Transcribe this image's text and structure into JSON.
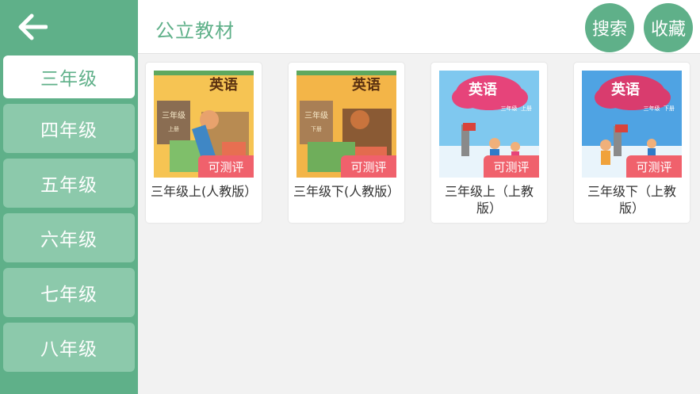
{
  "sidebar": {
    "grades": [
      {
        "label": "三年级"
      },
      {
        "label": "四年级"
      },
      {
        "label": "五年级"
      },
      {
        "label": "六年级"
      },
      {
        "label": "七年级"
      },
      {
        "label": "八年级"
      }
    ],
    "active_grade": "三年级"
  },
  "header": {
    "title": "公立教材",
    "search_label": "搜索",
    "favorites_label": "收藏"
  },
  "books": [
    {
      "title": "三年级上(人教版）",
      "badge": "可测评",
      "cover_text": "英语",
      "cover_sub": "三年级",
      "cover_vol": "上册"
    },
    {
      "title": "三年级下(人教版）",
      "badge": "可测评",
      "cover_text": "英语",
      "cover_sub": "三年级",
      "cover_vol": "下册"
    },
    {
      "title": "三年级上（上教版）",
      "badge": "可测评",
      "cover_text": "英语",
      "cover_sub": "三年级",
      "cover_vol": "上册"
    },
    {
      "title": "三年级下（上教版）",
      "badge": "可测评",
      "cover_text": "英语",
      "cover_sub": "三年级",
      "cover_vol": "下册"
    }
  ],
  "colors": {
    "accent": "#5fb089",
    "sidebar_item": "#8cc9ab",
    "badge": "#f0616c"
  }
}
